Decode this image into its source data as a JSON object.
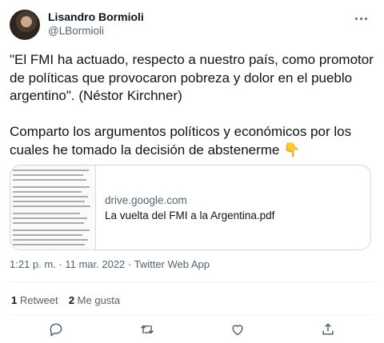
{
  "author": {
    "name": "Lisandro Bormioli",
    "handle": "@LBormioli"
  },
  "tweet": {
    "text": "\"El FMI ha actuado, respecto a nuestro país, como promotor de políticas que provocaron pobreza y dolor en el pueblo argentino\". (Néstor Kirchner)\n\nComparto los argumentos políticos y económicos por los cuales he tomado la decisión de abstenerme ",
    "emoji": "👇"
  },
  "card": {
    "domain": "drive.google.com",
    "title": "La vuelta del FMI a la Argentina.pdf"
  },
  "meta": {
    "timestamp": "1:21 p. m. · 11 mar. 2022 · Twitter Web App"
  },
  "stats": {
    "retweets_count": "1",
    "retweets_label": "Retweet",
    "likes_count": "2",
    "likes_label": "Me gusta"
  },
  "icons": [
    "reply-icon",
    "retweet-icon",
    "like-icon",
    "share-icon"
  ],
  "colors": {
    "text": "#0f1419",
    "secondary": "#536471",
    "border": "#cfd9de"
  }
}
